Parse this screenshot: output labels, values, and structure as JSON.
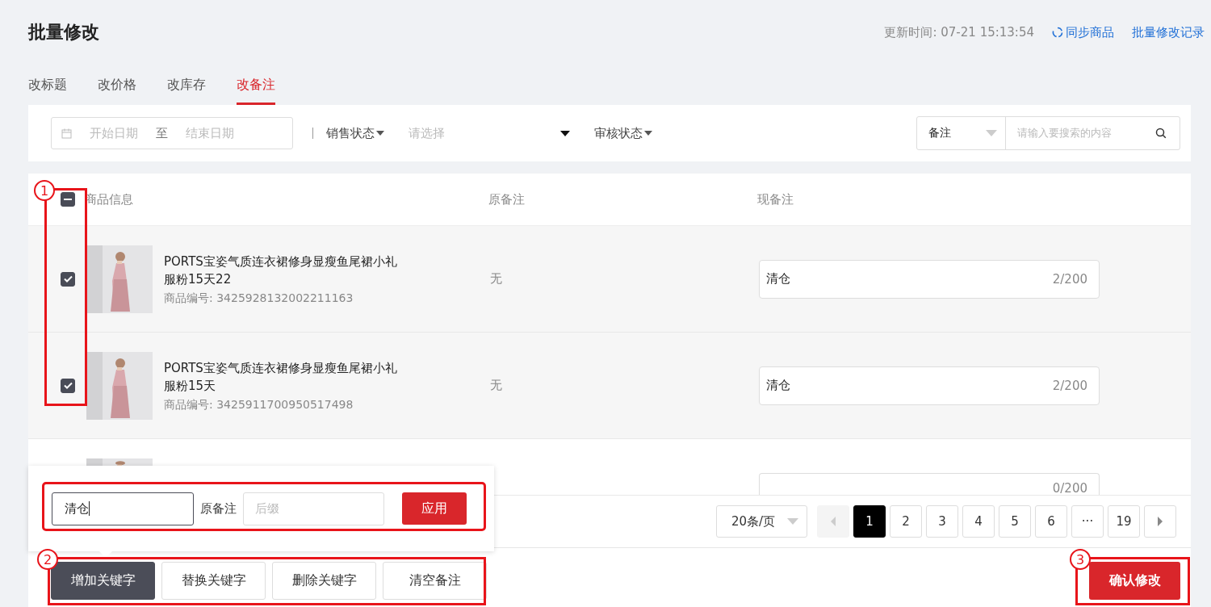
{
  "page": {
    "title": "批量修改",
    "updated": "更新时间: 07-21 15:13:54",
    "sync_link": "同步商品",
    "history_link": "批量修改记录"
  },
  "tabs": [
    {
      "label": "改标题",
      "selected": false
    },
    {
      "label": "改价格",
      "selected": false
    },
    {
      "label": "改库存",
      "selected": false
    },
    {
      "label": "改备注",
      "selected": true
    }
  ],
  "filters": {
    "start_date": {
      "placeholder": "开始日期"
    },
    "date_separator": "至",
    "end_date": {
      "placeholder": "结束日期"
    },
    "sales_status": "销售状态",
    "sales_select": {
      "placeholder": "请选择"
    },
    "audit_status": "审核状态",
    "search_type": "备注",
    "search": {
      "placeholder": "请输入要搜索的内容"
    }
  },
  "table": {
    "header_checkbox": {
      "indeterminate": true
    },
    "columns": [
      "商品信息",
      "原备注",
      "现备注"
    ],
    "rows": [
      {
        "checked": true,
        "title": "PORTS宝姿气质连衣裙修身显瘦鱼尾裙小礼服粉15天22",
        "code": "商品编号: 3425928132002211163",
        "original_remark": "无",
        "remark": "清仓",
        "count": "2/200"
      },
      {
        "checked": true,
        "title": "PORTS宝姿气质连衣裙修身显瘦鱼尾裙小礼服粉15天",
        "code": "商品编号: 3425911700950517498",
        "original_remark": "无",
        "remark": "清仓",
        "count": "2/200"
      },
      {
        "count": "0/200"
      }
    ]
  },
  "pagination": {
    "page_size": "20条/页",
    "pages": [
      {
        "label": "1",
        "selected": true
      },
      {
        "label": "2",
        "selected": false
      },
      {
        "label": "3",
        "selected": false
      },
      {
        "label": "4",
        "selected": false
      },
      {
        "label": "5",
        "selected": false
      },
      {
        "label": "6",
        "selected": false
      },
      {
        "label": "···",
        "selected": false
      },
      {
        "label": "19",
        "selected": false
      }
    ]
  },
  "popup": {
    "keyword": "清仓",
    "label": "原备注",
    "suffix": {
      "placeholder": "后缀"
    },
    "apply": "应用"
  },
  "actions": [
    {
      "label": "增加关键字",
      "selected": true
    },
    {
      "label": "替换关键字",
      "selected": false
    },
    {
      "label": "删除关键字",
      "selected": false
    },
    {
      "label": "清空备注",
      "selected": false
    }
  ],
  "confirm": "确认修改",
  "annotations": [
    {
      "number": "1"
    },
    {
      "number": "2"
    },
    {
      "number": "3"
    }
  ]
}
